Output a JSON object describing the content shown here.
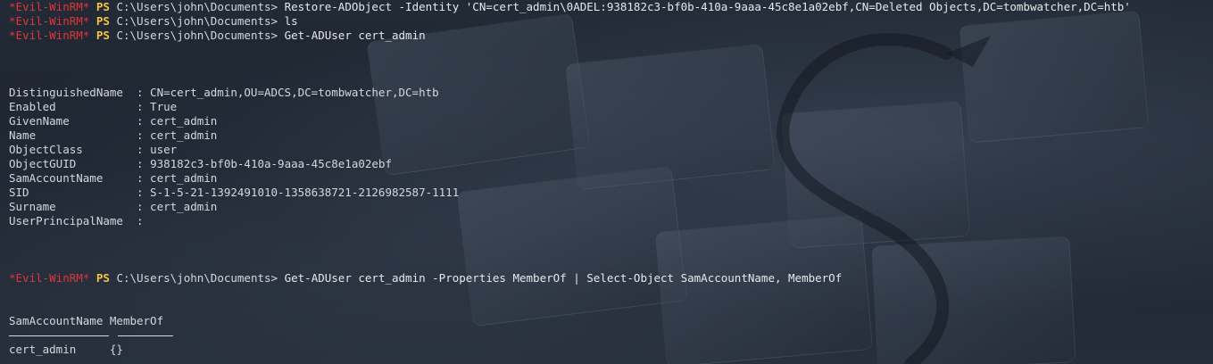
{
  "prompt": {
    "tag": "*Evil-WinRM*",
    "shell": "PS",
    "path": "C:\\Users\\john\\Documents>"
  },
  "commands": [
    "Restore-ADObject -Identity 'CN=cert_admin\\0ADEL:938182c3-bf0b-410a-9aaa-45c8e1a02ebf,CN=Deleted Objects,DC=tombwatcher,DC=htb'",
    "ls",
    "Get-ADUser cert_admin",
    "Get-ADUser cert_admin -Properties MemberOf | Select-Object SamAccountName, MemberOf"
  ],
  "user_properties": [
    {
      "key": "DistinguishedName",
      "value": "CN=cert_admin,OU=ADCS,DC=tombwatcher,DC=htb"
    },
    {
      "key": "Enabled",
      "value": "True"
    },
    {
      "key": "GivenName",
      "value": "cert_admin"
    },
    {
      "key": "Name",
      "value": "cert_admin"
    },
    {
      "key": "ObjectClass",
      "value": "user"
    },
    {
      "key": "ObjectGUID",
      "value": "938182c3-bf0b-410a-9aaa-45c8e1a02ebf"
    },
    {
      "key": "SamAccountName",
      "value": "cert_admin"
    },
    {
      "key": "SID",
      "value": "S-1-5-21-1392491010-1358638721-2126982587-1111"
    },
    {
      "key": "Surname",
      "value": "cert_admin"
    },
    {
      "key": "UserPrincipalName",
      "value": ""
    }
  ],
  "select_table": {
    "headers": [
      "SamAccountName",
      "MemberOf"
    ],
    "rows": [
      [
        "cert_admin",
        "{}"
      ]
    ]
  }
}
